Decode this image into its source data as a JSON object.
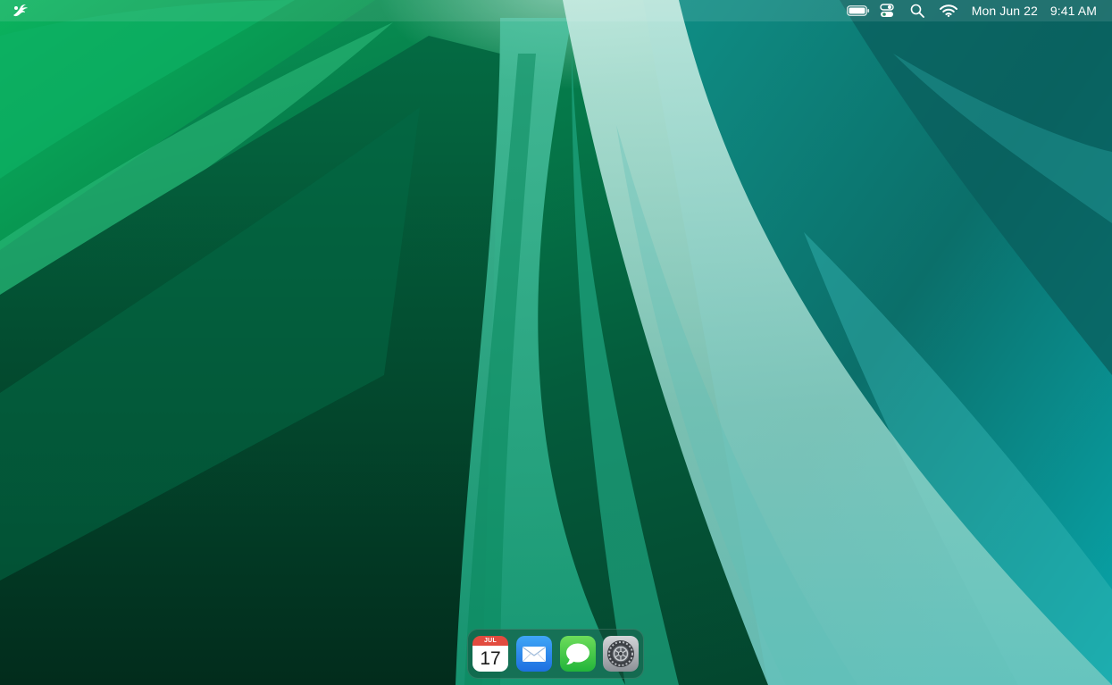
{
  "menubar": {
    "date": "Mon Jun 22",
    "time": "9:41 AM",
    "icons": [
      "app-logo-icon",
      "battery-icon",
      "control-center-icon",
      "spotlight-search-icon",
      "wifi-icon"
    ]
  },
  "dock": {
    "items": [
      {
        "name": "Calendar",
        "icon": "calendar-icon",
        "month": "JUL",
        "day": "17"
      },
      {
        "name": "Mail",
        "icon": "mail-icon"
      },
      {
        "name": "Messages",
        "icon": "messages-icon"
      },
      {
        "name": "System Settings",
        "icon": "settings-icon"
      }
    ]
  },
  "colors": {
    "wallpaper_primary": "#0a9a55",
    "wallpaper_dark": "#03402a",
    "wallpaper_teal": "#1fa9a8",
    "wallpaper_highlight": "#9fd9cf",
    "calendar_red": "#e24b3f",
    "mail_blue": "#3b8df0",
    "messages_green": "#3fc24a"
  }
}
